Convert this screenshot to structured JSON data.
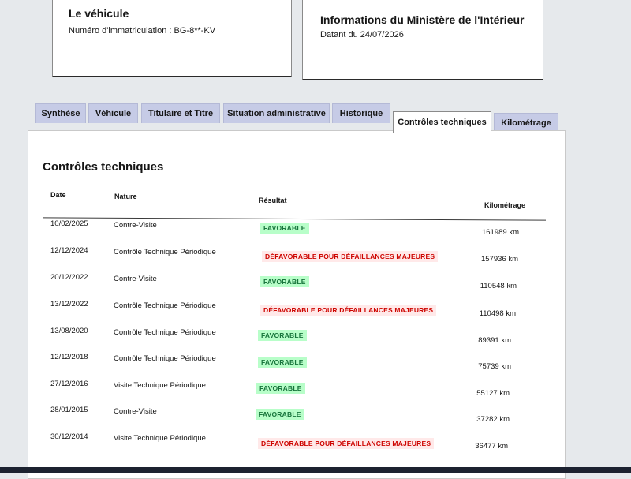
{
  "vehicle": {
    "title": "Le véhicule",
    "plate": "Numéro d'immatriculation : BG-8**-KV"
  },
  "ministry": {
    "title": "Informations du Ministère de l'Intérieur",
    "date": "Datant du 24/07/2026"
  },
  "tabs": [
    {
      "label": "Synthèse",
      "active": false
    },
    {
      "label": "Véhicule",
      "active": false
    },
    {
      "label": "Titulaire et Titre",
      "active": false
    },
    {
      "label": "Situation administrative",
      "active": false
    },
    {
      "label": "Historique",
      "active": false
    },
    {
      "label": "Contrôles techniques",
      "active": true
    },
    {
      "label": "Kilométrage",
      "active": false
    }
  ],
  "section": {
    "title": "Contrôles techniques"
  },
  "table": {
    "headers": {
      "date": "Date",
      "nature": "Nature",
      "result": "Résultat",
      "km": "Kilométrage"
    },
    "rows": [
      {
        "date": "10/02/2025",
        "nature": "Contre-Visite",
        "result": "FAVORABLE",
        "status": "ok",
        "km": "161989 km"
      },
      {
        "date": "12/12/2024",
        "nature": "Contrôle Technique Périodique",
        "result": "DÉFAVORABLE POUR DÉFAILLANCES MAJEURES",
        "status": "ko",
        "km": "157936 km"
      },
      {
        "date": "20/12/2022",
        "nature": "Contre-Visite",
        "result": "FAVORABLE",
        "status": "ok",
        "km": "110548 km"
      },
      {
        "date": "13/12/2022",
        "nature": "Contrôle Technique Périodique",
        "result": "DÉFAVORABLE POUR DÉFAILLANCES MAJEURES",
        "status": "ko",
        "km": "110498 km"
      },
      {
        "date": "13/08/2020",
        "nature": "Contrôle Technique Périodique",
        "result": "FAVORABLE",
        "status": "ok",
        "km": "89391 km"
      },
      {
        "date": "12/12/2018",
        "nature": "Contrôle Technique Périodique",
        "result": "FAVORABLE",
        "status": "ok",
        "km": "75739 km"
      },
      {
        "date": "27/12/2016",
        "nature": "Visite Technique Périodique",
        "result": "FAVORABLE",
        "status": "ok",
        "km": "55127 km"
      },
      {
        "date": "28/01/2015",
        "nature": "Contre-Visite",
        "result": "FAVORABLE",
        "status": "ok",
        "km": "37282 km"
      },
      {
        "date": "30/12/2014",
        "nature": "Visite Technique Périodique",
        "result": "DÉFAVORABLE POUR DÉFAILLANCES MAJEURES",
        "status": "ko",
        "km": "36477 km"
      }
    ]
  },
  "colors": {
    "favorable_bg": "#b8fec9",
    "favorable_text": "#18753c",
    "defavorable_bg": "#ffe9e9",
    "defavorable_text": "#ce0500",
    "tab_inactive": "#c6cbe6"
  }
}
